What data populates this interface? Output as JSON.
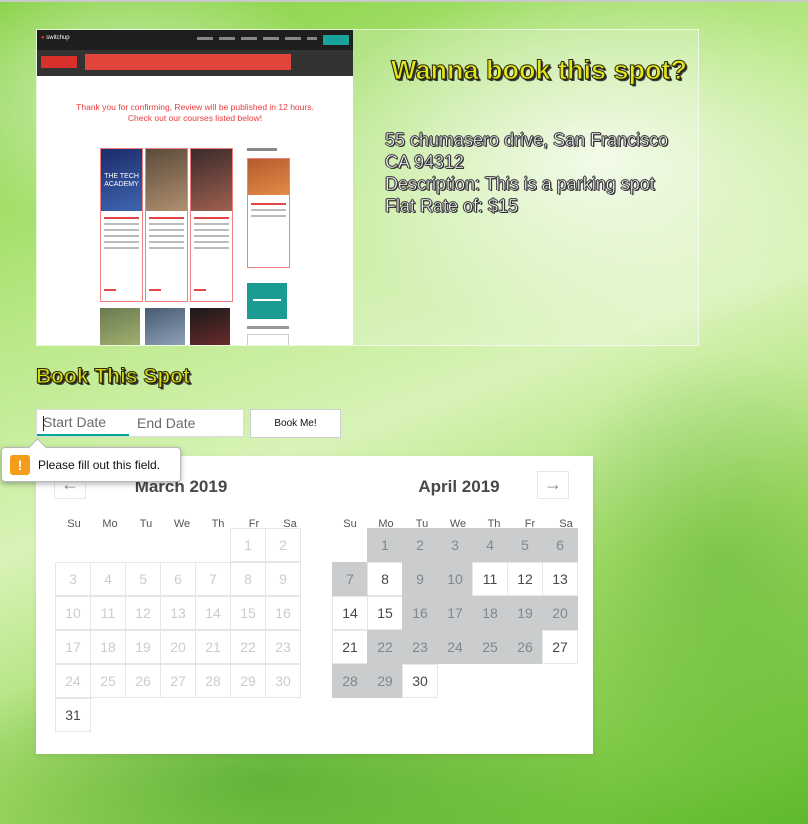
{
  "hero": {
    "title": "Wanna book this spot?",
    "address_line1": "55 chumasero drive, San Francisco",
    "address_line2": "CA 94312",
    "description": "Description: This is a parking spot",
    "rate": "Flat Rate of: $15",
    "thumbnail": {
      "logo_text": "switchup",
      "thank_you_text": "Thank you for confirming, Review will be published in 12 hours. Check out our courses listed below!"
    }
  },
  "booking": {
    "heading": "Book This Spot",
    "start_placeholder": "Start Date",
    "end_placeholder": "End Date",
    "submit_label": "Book Me!"
  },
  "validation": {
    "icon": "warning-icon",
    "message": "Please fill out this field."
  },
  "calendar": {
    "prev_icon": "←",
    "next_icon": "→",
    "weekdays": [
      "Su",
      "Mo",
      "Tu",
      "We",
      "Th",
      "Fr",
      "Sa"
    ],
    "months": [
      {
        "title": "March 2019",
        "weeks": [
          [
            {
              "d": ""
            },
            {
              "d": ""
            },
            {
              "d": ""
            },
            {
              "d": ""
            },
            {
              "d": ""
            },
            {
              "d": "1",
              "s": "past"
            },
            {
              "d": "2",
              "s": "past"
            }
          ],
          [
            {
              "d": "3",
              "s": "past"
            },
            {
              "d": "4",
              "s": "past"
            },
            {
              "d": "5",
              "s": "past"
            },
            {
              "d": "6",
              "s": "past"
            },
            {
              "d": "7",
              "s": "past"
            },
            {
              "d": "8",
              "s": "past"
            },
            {
              "d": "9",
              "s": "past"
            }
          ],
          [
            {
              "d": "10",
              "s": "past"
            },
            {
              "d": "11",
              "s": "past"
            },
            {
              "d": "12",
              "s": "past"
            },
            {
              "d": "13",
              "s": "past"
            },
            {
              "d": "14",
              "s": "past"
            },
            {
              "d": "15",
              "s": "past"
            },
            {
              "d": "16",
              "s": "past"
            }
          ],
          [
            {
              "d": "17",
              "s": "past"
            },
            {
              "d": "18",
              "s": "past"
            },
            {
              "d": "19",
              "s": "past"
            },
            {
              "d": "20",
              "s": "past"
            },
            {
              "d": "21",
              "s": "past"
            },
            {
              "d": "22",
              "s": "past"
            },
            {
              "d": "23",
              "s": "past"
            }
          ],
          [
            {
              "d": "24",
              "s": "past"
            },
            {
              "d": "25",
              "s": "past"
            },
            {
              "d": "26",
              "s": "past"
            },
            {
              "d": "27",
              "s": "past"
            },
            {
              "d": "28",
              "s": "past"
            },
            {
              "d": "29",
              "s": "past"
            },
            {
              "d": "30",
              "s": "past"
            }
          ],
          [
            {
              "d": "31",
              "s": "avail"
            }
          ]
        ]
      },
      {
        "title": "April 2019",
        "weeks": [
          [
            {
              "d": ""
            },
            {
              "d": "1",
              "s": "blocked"
            },
            {
              "d": "2",
              "s": "blocked"
            },
            {
              "d": "3",
              "s": "blocked"
            },
            {
              "d": "4",
              "s": "blocked"
            },
            {
              "d": "5",
              "s": "blocked"
            },
            {
              "d": "6",
              "s": "blocked"
            }
          ],
          [
            {
              "d": "7",
              "s": "blocked"
            },
            {
              "d": "8",
              "s": "avail"
            },
            {
              "d": "9",
              "s": "blocked"
            },
            {
              "d": "10",
              "s": "blocked"
            },
            {
              "d": "11",
              "s": "avail"
            },
            {
              "d": "12",
              "s": "avail"
            },
            {
              "d": "13",
              "s": "avail"
            }
          ],
          [
            {
              "d": "14",
              "s": "avail"
            },
            {
              "d": "15",
              "s": "avail"
            },
            {
              "d": "16",
              "s": "blocked"
            },
            {
              "d": "17",
              "s": "blocked"
            },
            {
              "d": "18",
              "s": "blocked"
            },
            {
              "d": "19",
              "s": "blocked"
            },
            {
              "d": "20",
              "s": "blocked"
            }
          ],
          [
            {
              "d": "21",
              "s": "avail"
            },
            {
              "d": "22",
              "s": "blocked"
            },
            {
              "d": "23",
              "s": "blocked"
            },
            {
              "d": "24",
              "s": "blocked"
            },
            {
              "d": "25",
              "s": "blocked"
            },
            {
              "d": "26",
              "s": "blocked"
            },
            {
              "d": "27",
              "s": "avail"
            }
          ],
          [
            {
              "d": "28",
              "s": "blocked"
            },
            {
              "d": "29",
              "s": "blocked"
            },
            {
              "d": "30",
              "s": "avail"
            }
          ]
        ]
      }
    ]
  },
  "colors": {
    "title_yellow": "#e3e61f",
    "accent_teal": "#00a699",
    "blocked_day": "#cacccd",
    "warning": "#f59c1a"
  }
}
